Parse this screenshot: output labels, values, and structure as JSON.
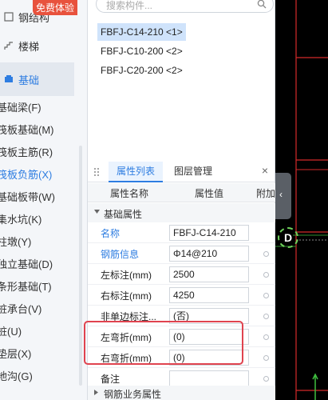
{
  "nav": {
    "free_badge": "免费体验",
    "top_items": [
      {
        "label": "钢结构",
        "icon": "steel-structure-icon"
      },
      {
        "label": "楼梯",
        "icon": "stair-icon"
      },
      {
        "label": "基础",
        "icon": "foundation-icon",
        "active": true
      }
    ],
    "sub_items": [
      "基础梁(F)",
      "筏板基础(M)",
      "筏板主筋(R)",
      "筏板负筋(X)",
      "基础板带(W)",
      "集水坑(K)",
      "柱墩(Y)",
      "独立基础(D)",
      "条形基础(T)",
      "桩承台(V)",
      "桩(U)",
      "垫层(X)",
      "地沟(G)"
    ],
    "active_sub": 3
  },
  "search": {
    "placeholder": "搜索构件..."
  },
  "components": [
    "FBFJ-C14-210 <1>",
    "FBFJ-C10-200 <2>",
    "FBFJ-C20-200 <2>"
  ],
  "props": {
    "tabs": [
      "属性列表",
      "图层管理"
    ],
    "headers": {
      "name": "属性名称",
      "value": "属性值",
      "extra": "附加"
    },
    "group1": "基础属性",
    "group2": "钢筋业务属性",
    "rows": [
      {
        "label": "名称",
        "value": "FBFJ-C14-210",
        "link": true
      },
      {
        "label": "钢筋信息",
        "value": "Φ14@210",
        "link": true
      },
      {
        "label": "左标注(mm)",
        "value": "2500"
      },
      {
        "label": "右标注(mm)",
        "value": "4250"
      },
      {
        "label": "非单边标注...",
        "value": "(否)"
      },
      {
        "label": "左弯折(mm)",
        "value": "(0)"
      },
      {
        "label": "右弯折(mm)",
        "value": "(0)"
      },
      {
        "label": "备注",
        "value": ""
      }
    ]
  },
  "canvas": {
    "marker": "D",
    "collapse_arrow": "‹"
  },
  "colors": {
    "accent": "#2e7de1",
    "highlight": "#e0434f",
    "badge": "#e8523d"
  }
}
